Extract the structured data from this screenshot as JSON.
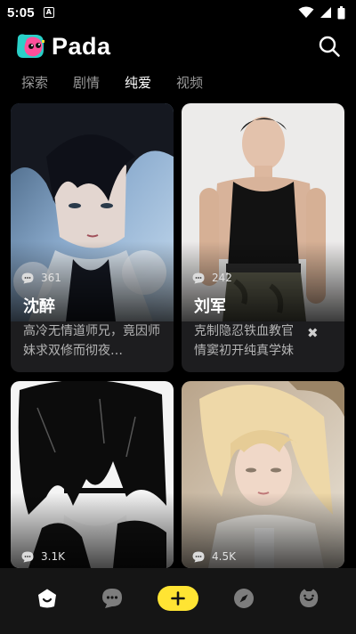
{
  "status_bar": {
    "time": "5:05",
    "notification_icon": "A"
  },
  "app": {
    "name": "Pada",
    "accent": "#ffe433"
  },
  "tabs": [
    {
      "label": "探索",
      "active": false
    },
    {
      "label": "剧情",
      "active": false
    },
    {
      "label": "纯爱",
      "active": true
    },
    {
      "label": "视频",
      "active": false
    }
  ],
  "cards": [
    {
      "name": "沈醉",
      "count": "361",
      "desc": "高冷无情道师兄，竟因师妹求双修而彻夜…"
    },
    {
      "name": "刘军",
      "count": "242",
      "desc": "克制隐忍铁血教官 情窦初开纯真学妹"
    },
    {
      "name": "",
      "count": "3.1K",
      "desc": ""
    },
    {
      "name": "",
      "count": "4.5K",
      "desc": ""
    }
  ],
  "bottom_nav": {
    "items": [
      "home-icon",
      "chat-icon",
      "create-icon",
      "discover-icon",
      "profile-icon"
    ],
    "active": "home-icon"
  }
}
